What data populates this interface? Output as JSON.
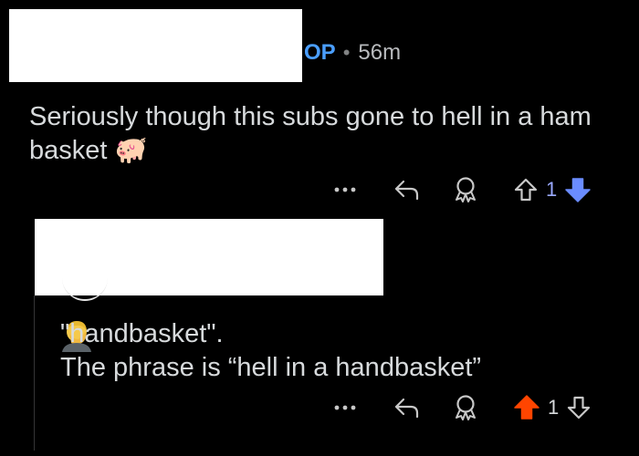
{
  "comment_1": {
    "op_badge": "OP",
    "separator": "•",
    "timestamp": "56m",
    "text": "Seriously though this subs gone to hell in a ham basket 🐖",
    "vote_count": "1"
  },
  "comment_2": {
    "text": "   \"handbasket\".\nThe phrase is “hell in a handbasket”",
    "vote_count": "1"
  },
  "icons": {
    "more": "more-options-icon",
    "reply": "reply-arrow-icon",
    "award": "award-icon",
    "upvote": "upvote-arrow-icon",
    "downvote": "downvote-arrow-icon",
    "facepalm": "facepalm-emoji-icon"
  },
  "colors": {
    "background": "#000000",
    "op_blue": "#4a9eff",
    "downvote_active": "#6a8cff",
    "upvote_active": "#ff4500",
    "text": "#d7dadc"
  }
}
